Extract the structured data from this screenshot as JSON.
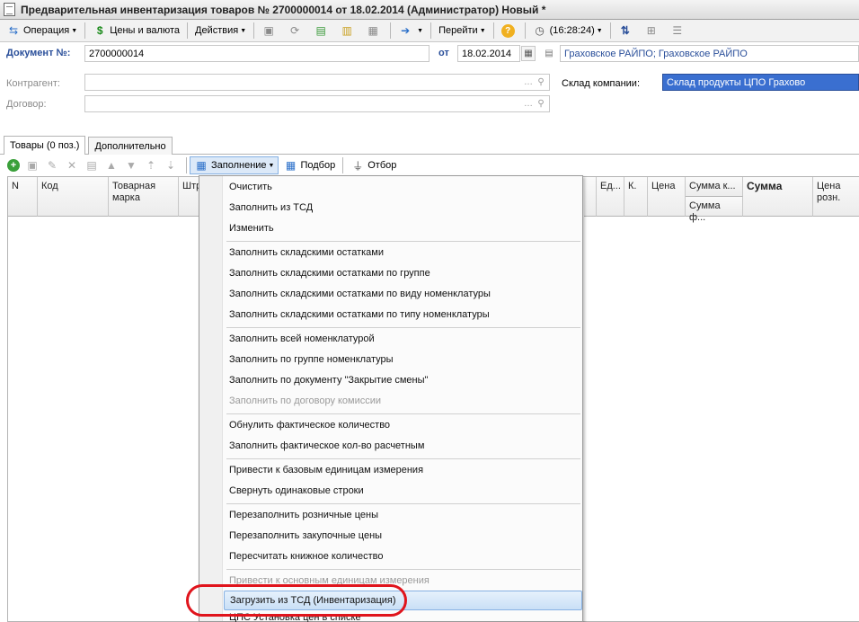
{
  "window": {
    "title": "Предварительная инвентаризация товаров № 2700000014 от 18.02.2014 (Администратор) Новый *"
  },
  "toolbar": {
    "operation": "Операция",
    "prices": "Цены и валюта",
    "actions": "Действия",
    "time": "(16:28:24)",
    "goto": "Перейти"
  },
  "header": {
    "doc_number_label": "Документ №:",
    "doc_number": "2700000014",
    "date_label": "от",
    "date": "18.02.2014",
    "organization": "Граховское РАЙПО; Граховское РАЙПО",
    "counterparty_label": "Контрагент:",
    "counterparty": "",
    "contract_label": "Договор:",
    "contract": "",
    "warehouse_label": "Склад компании:",
    "warehouse": "Склад продукты ЦПО Грахово"
  },
  "tabs": [
    "Товары (0 поз.)",
    "Дополнительно"
  ],
  "table_toolbar": {
    "fill": "Заполнение",
    "pick": "Подбор",
    "filter": "Отбор"
  },
  "columns": {
    "n": "N",
    "code": "Код",
    "brand": "Товарная марка",
    "barcode": "Штр",
    "unit": "Ед...",
    "k": "К.",
    "price": "Цена",
    "sum_k": "Сумма к...",
    "sum_f": "Сумма ф...",
    "sum": "Сумма",
    "retail_price": "Цена розн."
  },
  "menu": {
    "items": [
      "Очистить",
      "Заполнить из ТСД",
      "Изменить",
      "Заполнить складскими остатками",
      "Заполнить складскими остатками по группе",
      "Заполнить складскими остатками по виду номенклатуры",
      "Заполнить складскими остатками по типу номенклатуры",
      "Заполнить всей номенклатурой",
      "Заполнить по группе номенклатуры",
      "Заполнить по документу \"Закрытие смены\"",
      "Заполнить по договору комиссии",
      "Обнулить фактическое количество",
      "Заполнить фактическое кол-во расчетным",
      "Привести к базовым единицам измерения",
      "Свернуть одинаковые строки",
      "Перезаполнить розничные цены",
      "Перезаполнить закупочные цены",
      "Пересчитать книжное количество",
      "Привести к основным единицам измерения",
      "Загрузить из ТСД (Инвентаризация)",
      "ЦПС Установка цен в списке"
    ]
  },
  "colors": {
    "accent_blue": "#2a4f9a",
    "highlight_oval": "#e0141c",
    "menu_highlight": "#c9dff6"
  }
}
